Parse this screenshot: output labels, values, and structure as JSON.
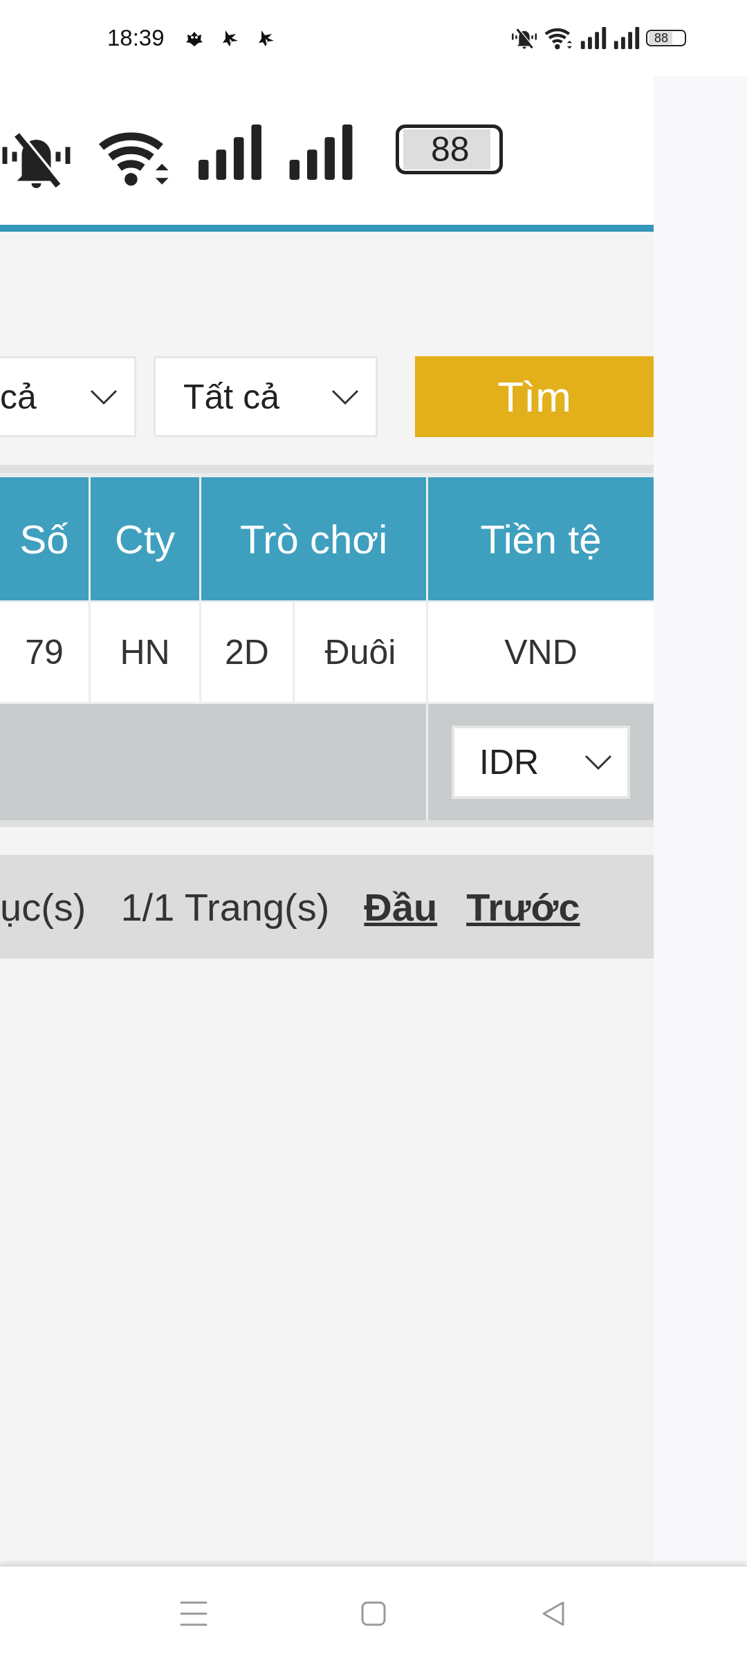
{
  "status_bar": {
    "time": "18:39",
    "battery": "88"
  },
  "page_banner": {
    "battery": "88"
  },
  "filters": [
    {
      "value": "cả"
    },
    {
      "value": "Tất cả"
    }
  ],
  "search_button": "Tìm",
  "table": {
    "columns": [
      {
        "label": "Số",
        "kind": "single"
      },
      {
        "label": "Cty",
        "kind": "single"
      },
      {
        "label": "Trò chơi",
        "kind": "double"
      },
      {
        "kind": "covered"
      },
      {
        "label": "Tiền tệ",
        "kind": "single"
      }
    ],
    "rows": [
      {
        "cells": [
          "79",
          "HN",
          "2D",
          "Đuôi",
          "VND"
        ]
      }
    ],
    "footer": {
      "currency": "IDR"
    }
  },
  "pagination": {
    "records": "ục(s)",
    "pages": "1/1 Trang(s)",
    "links": [
      "Đầu",
      "Trước"
    ]
  }
}
